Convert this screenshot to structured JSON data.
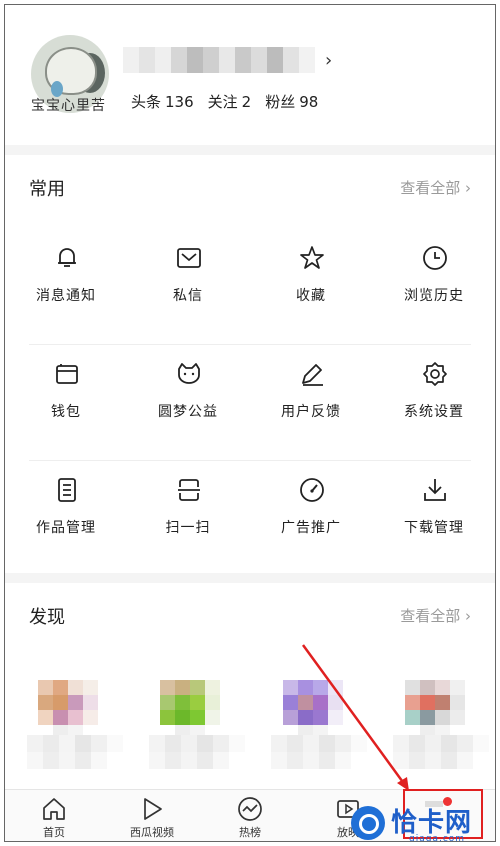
{
  "profile": {
    "avatar_text": "宝宝心里苦",
    "stats": [
      {
        "label": "头条",
        "value": "136"
      },
      {
        "label": "关注",
        "value": "2"
      },
      {
        "label": "粉丝",
        "value": "98"
      }
    ]
  },
  "common": {
    "title": "常用",
    "view_all": "查看全部",
    "items": [
      {
        "label": "消息通知",
        "icon": "bell-icon"
      },
      {
        "label": "私信",
        "icon": "mail-icon"
      },
      {
        "label": "收藏",
        "icon": "star-icon"
      },
      {
        "label": "浏览历史",
        "icon": "clock-icon"
      },
      {
        "label": "钱包",
        "icon": "wallet-icon"
      },
      {
        "label": "圆梦公益",
        "icon": "charity-icon"
      },
      {
        "label": "用户反馈",
        "icon": "feedback-icon"
      },
      {
        "label": "系统设置",
        "icon": "gear-icon"
      },
      {
        "label": "作品管理",
        "icon": "document-icon"
      },
      {
        "label": "扫一扫",
        "icon": "scan-icon"
      },
      {
        "label": "广告推广",
        "icon": "gauge-icon"
      },
      {
        "label": "下载管理",
        "icon": "download-icon"
      }
    ]
  },
  "discover": {
    "title": "发现",
    "view_all": "查看全部"
  },
  "tabbar": {
    "tabs": [
      {
        "label": "首页",
        "icon": "home-icon"
      },
      {
        "label": "西瓜视频",
        "icon": "play-icon"
      },
      {
        "label": "热榜",
        "icon": "trend-icon"
      },
      {
        "label": "放映",
        "icon": "video-icon"
      }
    ]
  },
  "watermark": {
    "text": "恰卡网",
    "sub": "qiaqa.com"
  },
  "colors": {
    "highlight_box": "#e02020",
    "watermark": "#1f5fc9"
  }
}
